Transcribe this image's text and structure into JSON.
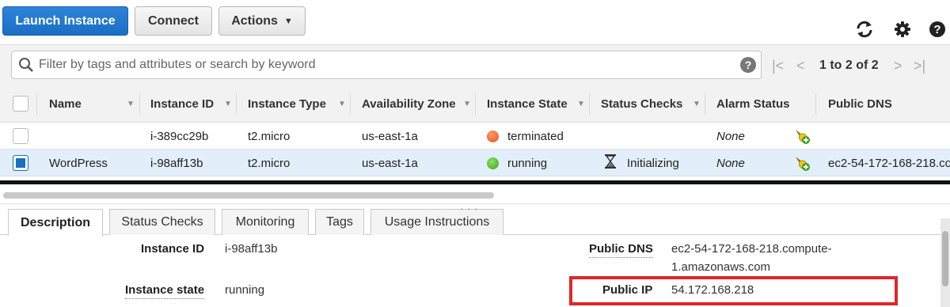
{
  "toolbar": {
    "launch_label": "Launch Instance",
    "connect_label": "Connect",
    "actions_label": "Actions",
    "icons": [
      "refresh-icon",
      "gear-icon",
      "help-icon"
    ]
  },
  "search": {
    "placeholder": "Filter by tags and attributes or search by keyword",
    "help": "?"
  },
  "pager": {
    "first": "|<",
    "prev": "<",
    "text": "1 to 2 of 2",
    "next": ">",
    "last": ">|"
  },
  "table": {
    "columns": [
      "Name",
      "Instance ID",
      "Instance Type",
      "Availability Zone",
      "Instance State",
      "Status Checks",
      "Alarm Status",
      "Public DNS"
    ],
    "rows": [
      {
        "name": "",
        "instance_id": "i-389cc29b",
        "type": "t2.micro",
        "zone": "us-east-1a",
        "state": "terminated",
        "state_color": "#e8501e",
        "status": "",
        "alarm": "None",
        "dns": ""
      },
      {
        "name": "WordPress",
        "instance_id": "i-98aff13b",
        "type": "t2.micro",
        "zone": "us-east-1a",
        "state": "running",
        "state_color": "#3aa21a",
        "status": "Initializing",
        "alarm": "None",
        "dns": "ec2-54-172-168-218.co"
      }
    ]
  },
  "detail": {
    "tabs": [
      "Description",
      "Status Checks",
      "Monitoring",
      "Tags",
      "Usage Instructions"
    ],
    "fields": {
      "instance_id_label": "Instance ID",
      "instance_id_value": "i-98aff13b",
      "instance_state_label": "Instance state",
      "instance_state_value": "running",
      "public_dns_label": "Public DNS",
      "public_dns_value_1": "ec2-54-172-168-218.compute-",
      "public_dns_value_2": "1.amazonaws.com",
      "public_ip_label": "Public IP",
      "public_ip_value": "54.172.168.218"
    }
  },
  "colors": {
    "primary": "#1a6ec4",
    "selected_row": "#e2eefa",
    "highlight": "#e0262a"
  }
}
